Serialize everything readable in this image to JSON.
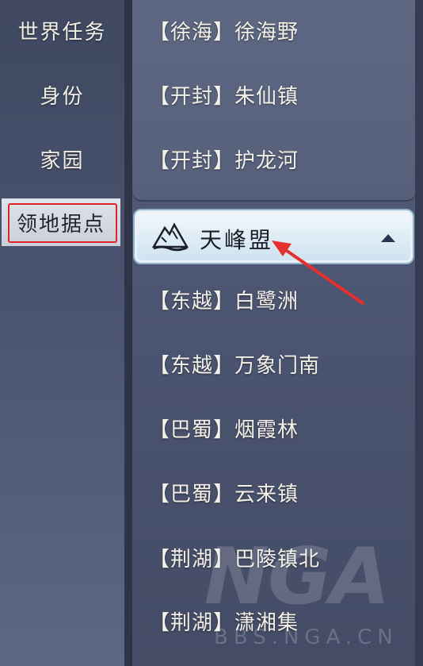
{
  "sidebar": {
    "items": [
      {
        "label": "世界任务"
      },
      {
        "label": "身份"
      },
      {
        "label": "家园"
      },
      {
        "label": "领地据点",
        "active": true
      }
    ]
  },
  "top_group": {
    "locations": [
      {
        "label": "【徐海】徐海野"
      },
      {
        "label": "【开封】朱仙镇"
      },
      {
        "label": "【开封】护龙河"
      }
    ]
  },
  "faction": {
    "name": "天峰盟",
    "icon": "mountain-emblem-icon",
    "expanded": true,
    "locations": [
      {
        "label": "【东越】白鹭洲"
      },
      {
        "label": "【东越】万象门南"
      },
      {
        "label": "【巴蜀】烟霞林"
      },
      {
        "label": "【巴蜀】云来镇"
      },
      {
        "label": "【荆湖】巴陵镇北"
      },
      {
        "label": "【荆湖】潇湘集"
      }
    ]
  },
  "watermark": {
    "logo": "NGA",
    "url": "BBS.NGA.CN"
  },
  "colors": {
    "highlight_border": "#e02424",
    "annotation_arrow": "#e53030",
    "header_bg": "#dbe9f4"
  }
}
